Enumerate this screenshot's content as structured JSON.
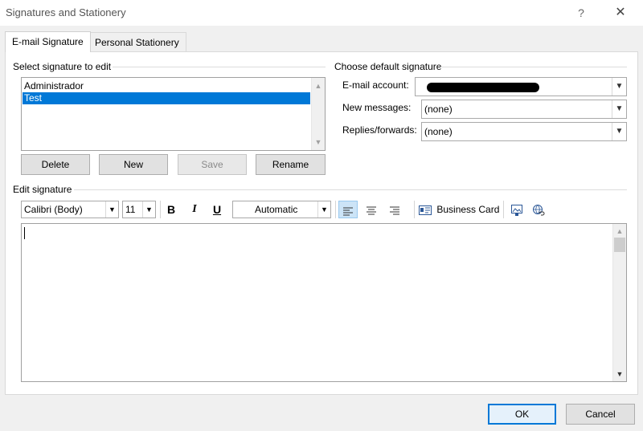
{
  "window": {
    "title": "Signatures and Stationery",
    "help_label": "?",
    "close_label": "✕"
  },
  "tabs": [
    {
      "label": "E-mail Signature",
      "active": true
    },
    {
      "label": "Personal Stationery",
      "active": false
    }
  ],
  "select_signature": {
    "group_label": "Select signature to edit",
    "items": [
      "Administrador",
      "Test"
    ],
    "selected_index": 1
  },
  "signature_buttons": {
    "delete": "Delete",
    "new": "New",
    "save": "Save",
    "rename": "Rename"
  },
  "default_signature": {
    "group_label": "Choose default signature",
    "email_account_label": "E-mail account:",
    "new_messages_label": "New messages:",
    "new_messages_value": "(none)",
    "replies_forwards_label": "Replies/forwards:",
    "replies_forwards_value": "(none)"
  },
  "edit_signature": {
    "group_label": "Edit signature",
    "font": "Calibri (Body)",
    "size": "11",
    "bold": "B",
    "italic": "I",
    "underline": "U",
    "color": "Automatic",
    "business_card": "Business Card",
    "content": ""
  },
  "footer": {
    "ok": "OK",
    "cancel": "Cancel"
  },
  "colors": {
    "selection": "#0078d7",
    "primary_border": "#0078d7"
  }
}
